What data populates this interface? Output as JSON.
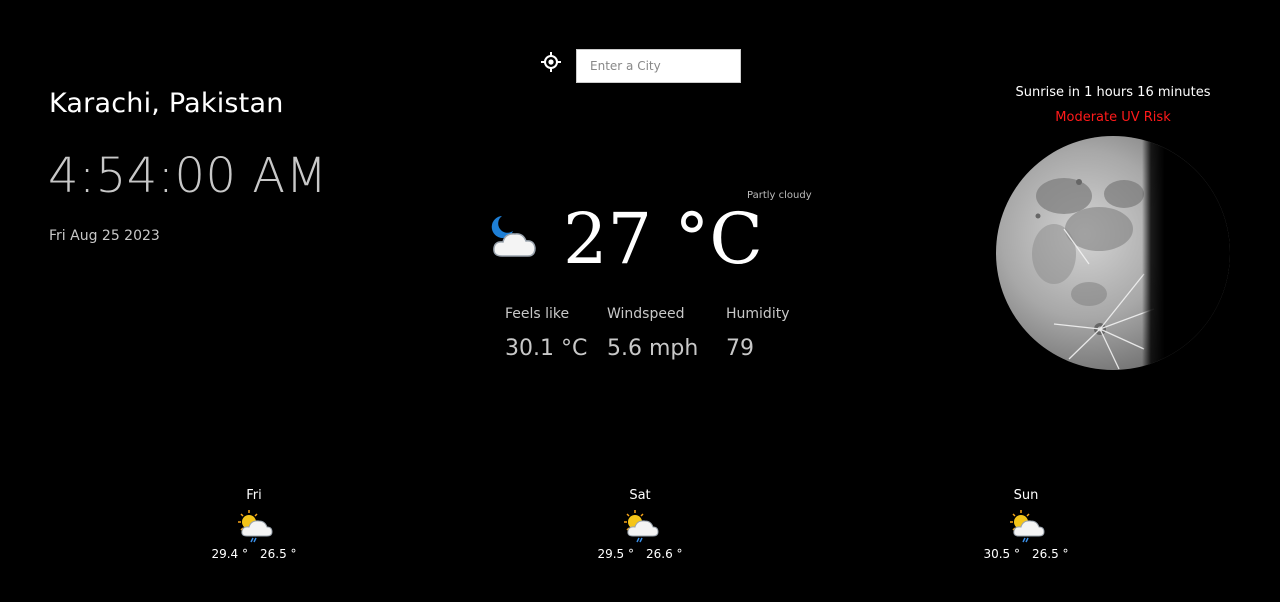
{
  "search": {
    "placeholder": "Enter a City",
    "value": ""
  },
  "location": {
    "name": "Karachi, Pakistan"
  },
  "clock": {
    "time": "4:54:00 AM",
    "date": "Fri Aug 25 2023"
  },
  "current": {
    "condition": "Partly cloudy",
    "icon": "partly-cloudy-night-icon",
    "temperature": "27 °C",
    "stats": [
      {
        "label": "Feels like",
        "value": "30.1 °C"
      },
      {
        "label": "Windspeed",
        "value": "5.6 mph"
      },
      {
        "label": "Humidity",
        "value": "79"
      }
    ]
  },
  "sun": {
    "sunrise_text": "Sunrise in 1 hours 16 minutes",
    "uv_text": "Moderate UV Risk",
    "uv_color": "#ff1a1a"
  },
  "moon": {
    "icon": "moon-phase-icon"
  },
  "forecast": [
    {
      "day": "Fri",
      "icon": "sun-cloud-rain-icon",
      "high": "29.4 °",
      "low": "26.5 °"
    },
    {
      "day": "Sat",
      "icon": "sun-cloud-rain-icon",
      "high": "29.5 °",
      "low": "26.6 °"
    },
    {
      "day": "Sun",
      "icon": "sun-cloud-rain-icon",
      "high": "30.5 °",
      "low": "26.5 °"
    }
  ]
}
